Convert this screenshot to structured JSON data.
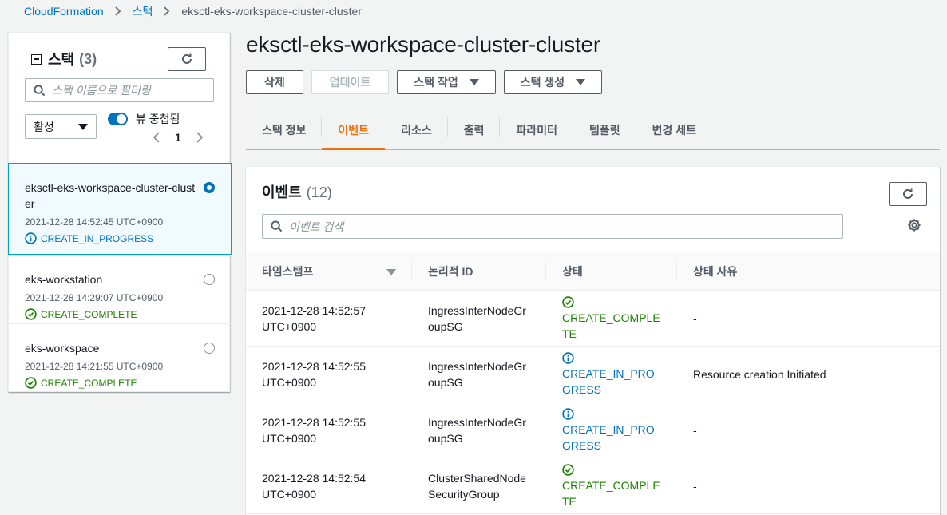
{
  "breadcrumb": {
    "items": [
      "CloudFormation",
      "스택"
    ],
    "current": "eksctl-eks-workspace-cluster-cluster"
  },
  "left_panel": {
    "title": "스택",
    "count": "(3)",
    "search_placeholder": "스택 이름으로 필터링",
    "filter_value": "활성",
    "toggle_label": "뷰 중첩됨",
    "page": "1",
    "stacks": [
      {
        "name": "eksctl-eks-workspace-cluster-cluster",
        "time": "2021-12-28 14:52:45 UTC+0900",
        "status": "CREATE_IN_PROGRESS",
        "status_icon": "info-icon",
        "selected": true
      },
      {
        "name": "eks-workstation",
        "time": "2021-12-28 14:29:07 UTC+0900",
        "status": "CREATE_COMPLETE",
        "status_icon": "check-circle-icon",
        "selected": false
      },
      {
        "name": "eks-workspace",
        "time": "2021-12-28 14:21:55 UTC+0900",
        "status": "CREATE_COMPLETE",
        "status_icon": "check-circle-icon",
        "selected": false
      }
    ]
  },
  "main": {
    "title": "eksctl-eks-workspace-cluster-cluster",
    "actions": {
      "delete": "삭제",
      "update": "업데이트",
      "stack_actions": "스택 작업",
      "create_stack": "스택 생성"
    },
    "tabs": [
      "스택 정보",
      "이벤트",
      "리소스",
      "출력",
      "파라미터",
      "템플릿",
      "변경 세트"
    ],
    "active_tab": "이벤트"
  },
  "events": {
    "title": "이벤트",
    "count": "(12)",
    "search_placeholder": "이벤트 검색",
    "columns": [
      "타임스탬프",
      "논리적 ID",
      "상태",
      "상태 사유"
    ],
    "rows": [
      {
        "timestamp": "2021-12-28 14:52:57 UTC+0900",
        "logical_id": "IngressInterNodeGroupSG",
        "status": "CREATE_COMPLETE",
        "kind": "ok",
        "reason": "-"
      },
      {
        "timestamp": "2021-12-28 14:52:55 UTC+0900",
        "logical_id": "IngressInterNodeGroupSG",
        "status": "CREATE_IN_PROGRESS",
        "kind": "info",
        "reason": "Resource creation Initiated"
      },
      {
        "timestamp": "2021-12-28 14:52:55 UTC+0900",
        "logical_id": "IngressInterNodeGroupSG",
        "status": "CREATE_IN_PROGRESS",
        "kind": "info",
        "reason": "-"
      },
      {
        "timestamp": "2021-12-28 14:52:54 UTC+0900",
        "logical_id": "ClusterSharedNodeSecurityGroup",
        "status": "CREATE_COMPLETE",
        "kind": "ok",
        "reason": "-"
      }
    ]
  },
  "colors": {
    "link": "#0073bb",
    "accent": "#ec7211",
    "success": "#1d8102",
    "info": "#0073bb"
  }
}
